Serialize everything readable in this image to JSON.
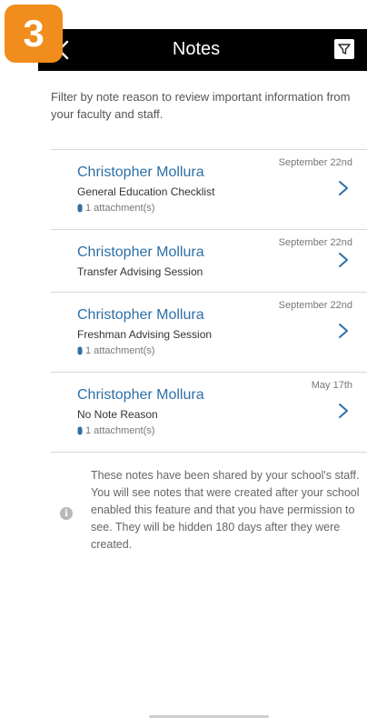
{
  "step_badge": "3",
  "header": {
    "title": "Notes",
    "back_icon": "chevron-left-icon",
    "filter_icon": "filter-icon"
  },
  "intro_text": "Filter by note reason to review important information from your faculty and staff.",
  "notes": [
    {
      "name": "Christopher Mollura",
      "reason": "General Education Checklist",
      "date": "September 22nd",
      "attachments": "1 attachment(s)"
    },
    {
      "name": "Christopher Mollura",
      "reason": "Transfer Advising Session",
      "date": "September 22nd",
      "attachments": ""
    },
    {
      "name": "Christopher Mollura",
      "reason": "Freshman Advising Session",
      "date": "September 22nd",
      "attachments": "1 attachment(s)"
    },
    {
      "name": "Christopher Mollura",
      "reason": "No Note Reason",
      "date": "May 17th",
      "attachments": "1 attachment(s)"
    }
  ],
  "info": {
    "icon": "info-icon",
    "text": "These notes have been shared by your school's staff. You will see notes that were created after your school enabled this feature and that you have permission to see. They will be hidden 180 days after they were created."
  },
  "colors": {
    "badge": "#f08d1d",
    "header_bg": "#000000",
    "link": "#2d6fa6"
  }
}
